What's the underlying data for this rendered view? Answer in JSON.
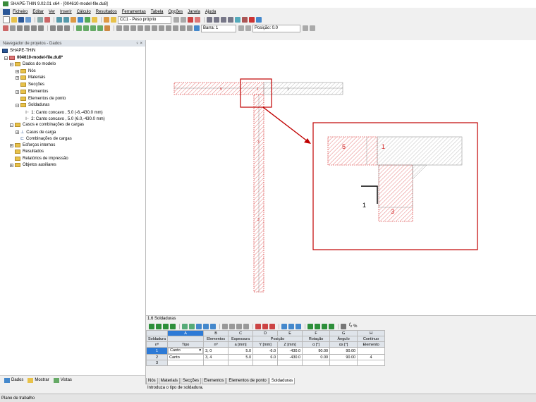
{
  "window": {
    "title": "SHAPE-THIN 9.02.01 x64 - [004610-model-file.du8]"
  },
  "menu": [
    "Ficheiro",
    "Editar",
    "Ver",
    "Inserir",
    "Cálculo",
    "Resultados",
    "Ferramentas",
    "Tabela",
    "Opções",
    "Janela",
    "Ajuda"
  ],
  "toolbar": {
    "loadcase": "CC1 - Peso próprio",
    "bar": "Barra: 1",
    "position": "Posição: 0.0"
  },
  "navigator": {
    "title": "Navegador de projetos - Dados",
    "pin": "♀ ×",
    "root": "SHAPE-THIN",
    "file": "004610-model-file.du8*",
    "items": [
      "Dados do modelo",
      "Nós",
      "Materiais",
      "Secções",
      "Elementos",
      "Elementos de ponto",
      "Soldaduras",
      "1: Canto concavo , 5.0 (-6,-430.0 mm)",
      "2: Canto concavo , 5.0 (6.0,-430.0 mm)",
      "Casos e combinações de cargas",
      "Casos de carga",
      "Combinações de cargas",
      "Esforços internos",
      "Resultados",
      "Relatórios de impressão",
      "Objetos auxiliares"
    ],
    "bottom_tabs": [
      "Dados",
      "Mostrar",
      "Vistas"
    ]
  },
  "canvas": {
    "labels": {
      "flange_left": "5",
      "flange_mid": "1",
      "flange_right": "1",
      "web": "3",
      "web_mid": "3"
    },
    "zoom_labels": {
      "left": "5",
      "mid": "1",
      "weld": "1",
      "web": "3"
    }
  },
  "table": {
    "title": "1.6 Soldaduras",
    "col_letters": [
      "A",
      "B",
      "C",
      "D",
      "E",
      "F",
      "G",
      "H"
    ],
    "col_names_1": [
      "Soldadura",
      "",
      "Elementos",
      "Espessura",
      "Posição",
      "",
      "Rotação",
      "Ângulo",
      "Contínuo"
    ],
    "col_names_2": [
      "nº",
      "Tipo",
      "nº",
      "a [mm]",
      "Y [mm]",
      "Z [mm]",
      "α [°]",
      "αs [°]",
      "Elemento"
    ],
    "rows": [
      [
        "1",
        "Canto",
        "3, 0",
        "5.0",
        "-6.0",
        "-430.0",
        "90.00",
        "90.00",
        ""
      ],
      [
        "2",
        "Canto",
        "3, 4",
        "5.0",
        "6.0",
        "-430.0",
        "0.00",
        "90.00",
        "4"
      ],
      [
        "3",
        "",
        "",
        "",
        "",
        "",
        "",
        "",
        ""
      ]
    ],
    "tabs": [
      "Nós",
      "Materiais",
      "Secções",
      "Elementos",
      "Elementos de ponto",
      "Soldaduras"
    ],
    "hint": "Introduza o tipo de soldadura."
  },
  "status": {
    "text": "Plano de trabalho"
  },
  "colors": {
    "member": "#d62828",
    "accent": "#2d7ad6"
  }
}
